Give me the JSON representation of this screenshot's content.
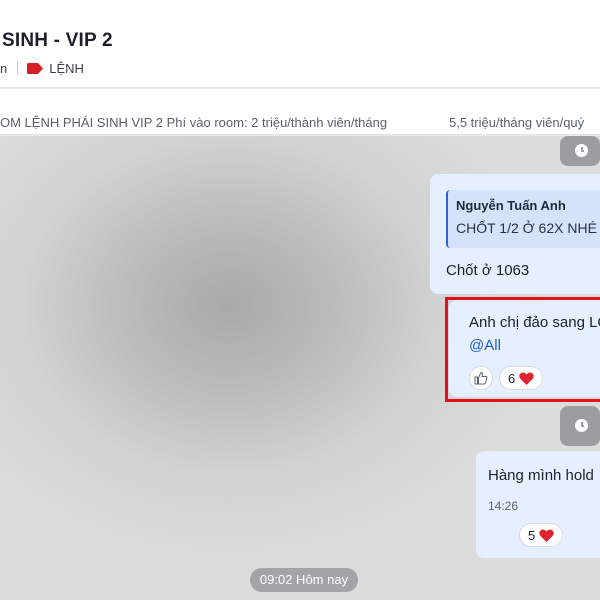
{
  "header": {
    "title": "SINH - VIP 2",
    "sub_left": "n",
    "tag_label": "LỆNH"
  },
  "pinned": {
    "left_text": "OM LỆNH PHÁI SINH VIP 2 Phí vào room: 2 triệu/thành viên/tháng",
    "right_text": "5,5 triệu/tháng viên/quý"
  },
  "messages": [
    {
      "quote_author": "Nguyễn Tuấn Anh",
      "quote_text": "CHỐT 1/2 Ở 62X NHÉ",
      "text": "Chốt  ở 1063"
    },
    {
      "text": "Anh chị đảo sang LO",
      "mention": "@All",
      "reaction_count": "6"
    },
    {
      "text": "Hàng mình hold",
      "time": "14:26",
      "reaction_count": "5"
    }
  ],
  "date_separator": "09:02 Hôm nay",
  "colors": {
    "accent": "#1d5fd0",
    "bubble": "#e5efff",
    "highlight": "#e0131a",
    "tag": "#d61f26",
    "heart": "#e0242f"
  },
  "icons": {
    "tag": "tag-icon",
    "clock": "clock-icon",
    "like": "thumbs-up-icon",
    "heart": "heart-icon"
  }
}
